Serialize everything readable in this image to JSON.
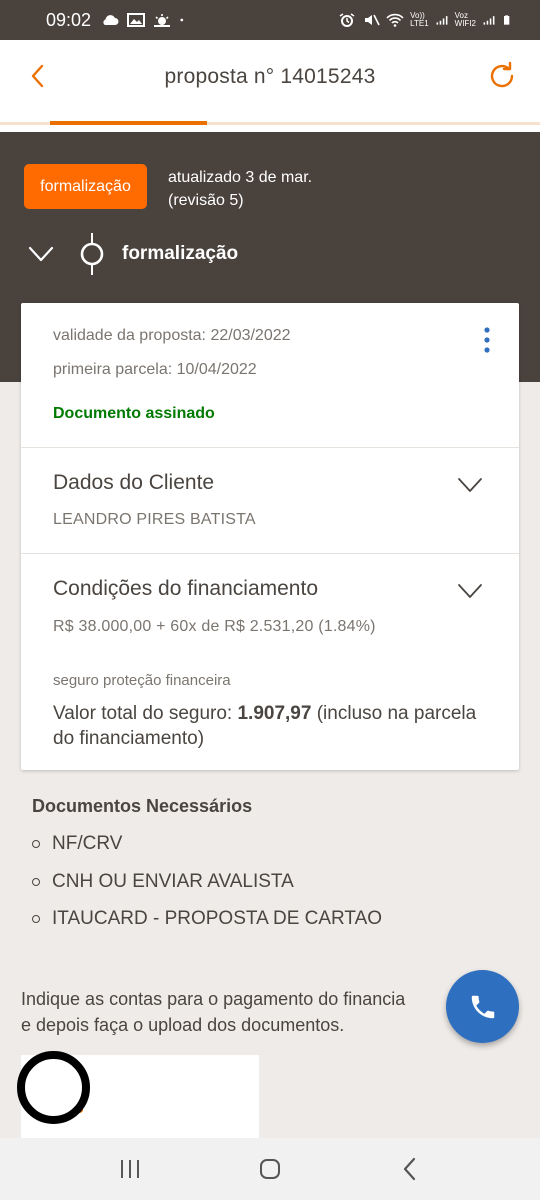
{
  "status_bar": {
    "time": "09:02",
    "left_icons": [
      "cloud-icon",
      "image-icon",
      "weather-icon",
      "dot-icon"
    ],
    "right_icons": [
      "alarm-icon",
      "mute-icon",
      "wifi-icon",
      "signal-icon",
      "signal-icon",
      "battery-icon"
    ],
    "volte_label": "Vo))\nLTE1",
    "vowifi_label": "Voz\nWIFI2"
  },
  "header": {
    "title": "proposta n° 14015243",
    "back_icon": "chevron-left-icon",
    "refresh_icon": "refresh-icon",
    "progress_fraction": 0.29
  },
  "stage": {
    "badge": "formalização",
    "updated_line1": "atualizado 3 de mar.",
    "updated_line2": "(revisão 5)",
    "current_stage": "formalização"
  },
  "proposal_card": {
    "validity": "validade da proposta: 22/03/2022",
    "first_installment": "primeira parcela: 10/04/2022",
    "status": "Documento assinado",
    "client_section_title": "Dados do Cliente",
    "client_name": "LEANDRO PIRES BATISTA",
    "financing_section_title": "Condições do financiamento",
    "financing_summary": "R$ 38.000,00 + 60x de R$ 2.531,20 (1.84%)",
    "insurance_label": "seguro proteção financeira",
    "insurance_total_prefix": "Valor total do seguro:",
    "insurance_total_value": "1.907,97",
    "insurance_total_suffix": "(incluso na parcela do financiamento)"
  },
  "documents": {
    "title": "Documentos Necessários",
    "items": [
      "NF/CRV",
      "CNH OU ENVIAR AVALISTA",
      "ITAUCARD - PROPOSTA DE CARTAO"
    ]
  },
  "instructions": {
    "line1": "Indique as contas para o pagamento do financia",
    "line2": "e depois faça o upload dos documentos."
  },
  "colors": {
    "accent": "#ec7000",
    "badge": "#ff6b00",
    "dark_header": "#4a423d",
    "success": "#007a00",
    "fab": "#2f6fbf"
  }
}
